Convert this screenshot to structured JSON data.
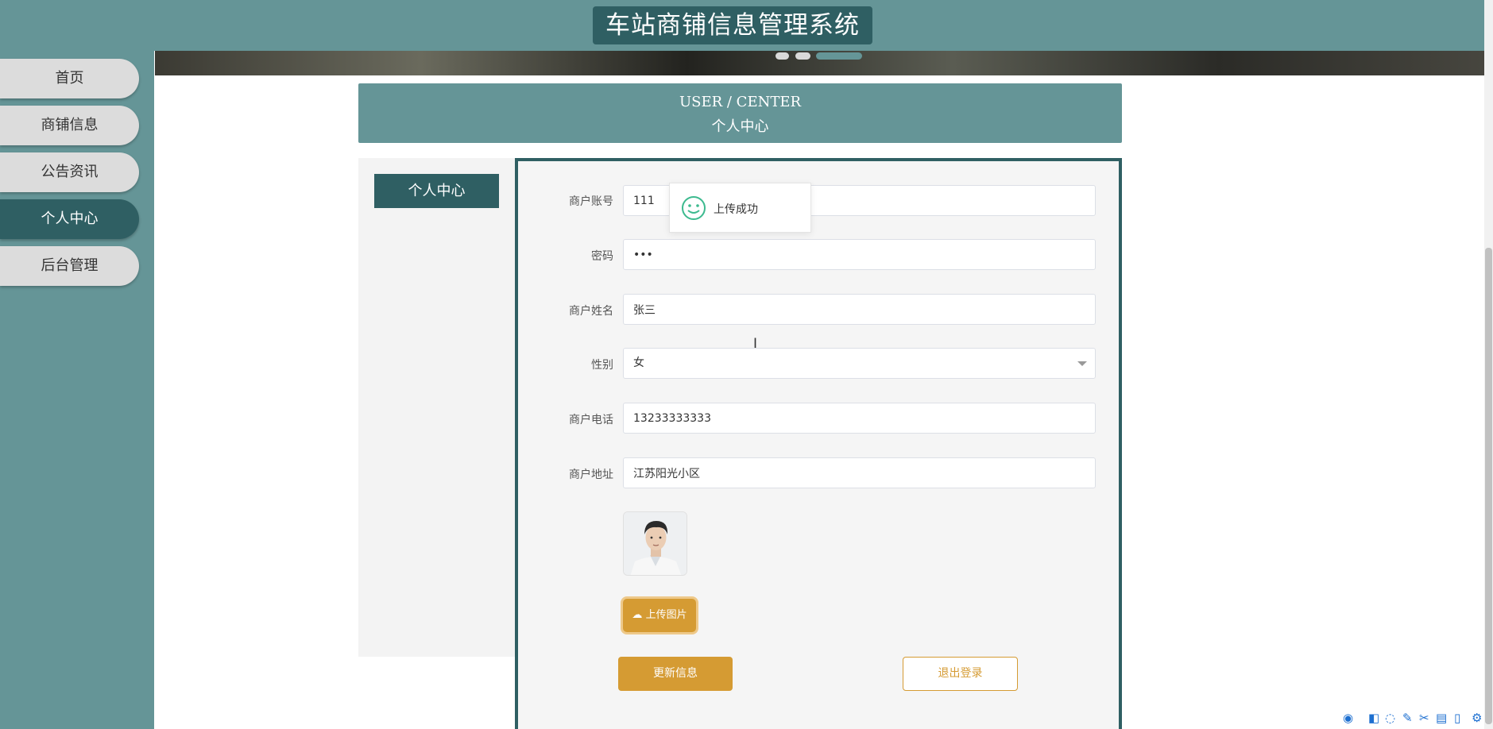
{
  "app": {
    "title": "车站商铺信息管理系统"
  },
  "sidebar": {
    "items": [
      {
        "label": "首页",
        "active": false
      },
      {
        "label": "商铺信息",
        "active": false
      },
      {
        "label": "公告资讯",
        "active": false
      },
      {
        "label": "个人中心",
        "active": true
      },
      {
        "label": "后台管理",
        "active": false
      }
    ]
  },
  "header": {
    "en": "USER / CENTER",
    "cn": "个人中心"
  },
  "left_panel": {
    "tab_label": "个人中心"
  },
  "form": {
    "account_label": "商户账号",
    "account_value": "111",
    "password_label": "密码",
    "password_value": "•••",
    "name_label": "商户姓名",
    "name_value": "张三",
    "gender_label": "性别",
    "gender_value": "女",
    "phone_label": "商户电话",
    "phone_value": "13233333333",
    "address_label": "商户地址",
    "address_value": "江苏阳光小区",
    "upload_label": "上传图片",
    "update_label": "更新信息",
    "logout_label": "退出登录"
  },
  "toast": {
    "message": "上传成功",
    "icon": "smiley-icon"
  },
  "colors": {
    "primary": "#659597",
    "dark": "#2f5f63",
    "accent": "#d59b33"
  }
}
